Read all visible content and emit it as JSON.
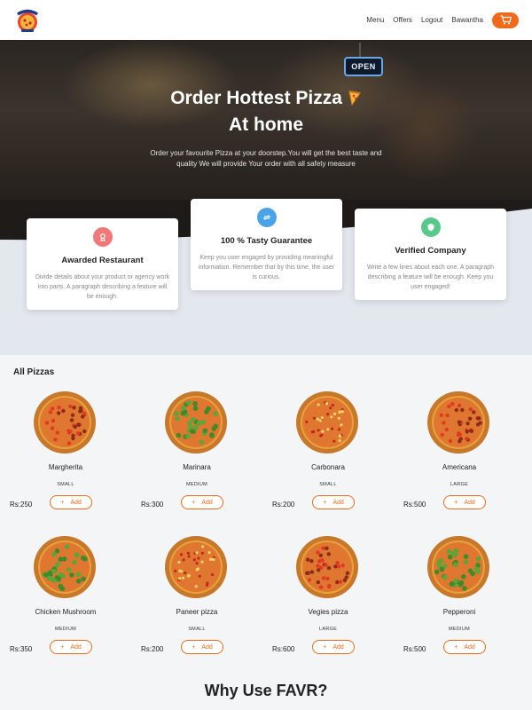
{
  "nav": {
    "links": [
      "Menu",
      "Offers",
      "Logout",
      "Bawantha"
    ],
    "cart_icon": "cart-icon",
    "accent": "#f06a1a"
  },
  "hero": {
    "title_line1": "Order Hottest Pizza",
    "title_line2": "At home",
    "subtitle": "Order your favourite Pizza at your doorstep.You will get the best taste and quality We will provide Your order with all safety measure",
    "sign": "OPEN"
  },
  "features": [
    {
      "title": "Awarded Restaurant",
      "text": "Divide details about your product or agency work into parts. A paragraph describing a feature will be enough.",
      "icon": "award-icon",
      "color": "#f07878"
    },
    {
      "title": "100 % Tasty Guarantee",
      "text": "Keep you user engaged by providing meaningful information. Remember that by this time, the user is curious.",
      "icon": "repeat-icon",
      "color": "#4aa3e6"
    },
    {
      "title": "Verified Company",
      "text": "Write a few lines about each one. A paragraph describing a feature will be enough. Keep you user engaged!",
      "icon": "shield-icon",
      "color": "#58c98a"
    }
  ],
  "pizzas_title": "All Pizzas",
  "add_label": "Add",
  "add_icon": "+",
  "pizzas": [
    {
      "name": "Margherita",
      "size": "SMALL",
      "price": "Rs:250"
    },
    {
      "name": "Marinara",
      "size": "MEDIUM",
      "price": "Rs:300"
    },
    {
      "name": "Carbonara",
      "size": "SMALL",
      "price": "Rs:200"
    },
    {
      "name": "Americana",
      "size": "LARGE",
      "price": "Rs:500"
    },
    {
      "name": "Chicken Mushroom",
      "size": "MEDIUM",
      "price": "Rs:350"
    },
    {
      "name": "Paneer pizza",
      "size": "SMALL",
      "price": "Rs:200"
    },
    {
      "name": "Vegies pizza",
      "size": "LARGE",
      "price": "Rs:600"
    },
    {
      "name": "Pepperoni",
      "size": "MEDIUM",
      "price": "Rs:500"
    }
  ],
  "why_title": "Why Use FAVR?"
}
